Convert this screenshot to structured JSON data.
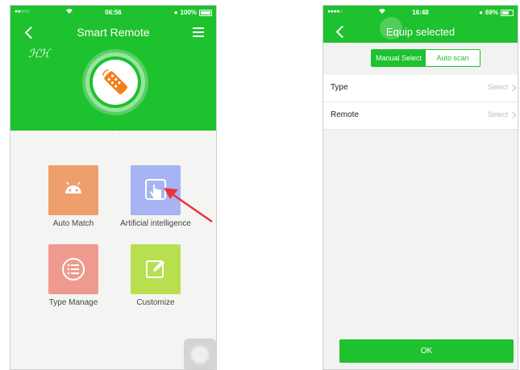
{
  "colors": {
    "brand_green": "#1ec12e",
    "tile_orange": "#ef9f6c",
    "tile_blue": "#a7b4f3",
    "tile_pink": "#ee9a8f",
    "tile_lime": "#b8df4f",
    "arrow_red": "#e8353a"
  },
  "left_screen": {
    "status": {
      "signal": "●●○○○",
      "wifi_icon": "wifi-icon",
      "time": "06:56",
      "battery": "100%"
    },
    "header": {
      "title": "Smart Remote",
      "back_icon": "chevron-left-icon",
      "menu_icon": "list-menu-icon",
      "logo_mark": "ℋℋ"
    },
    "hero_icon": "remote-control-icon",
    "carousel": {
      "pages": 2,
      "active": 1
    },
    "tiles": [
      {
        "label": "Auto Match",
        "icon": "android-icon"
      },
      {
        "label": "Artificial intelligence",
        "icon": "hand-tap-icon"
      },
      {
        "label": "Type Manage",
        "icon": "list-circle-icon"
      },
      {
        "label": "Customize",
        "icon": "edit-pencil-icon"
      }
    ]
  },
  "right_screen": {
    "status": {
      "signal": "●●●●○",
      "wifi_icon": "wifi-icon",
      "time": "16:48",
      "battery": "69%"
    },
    "header": {
      "title": "Equip selected",
      "back_icon": "chevron-left-icon"
    },
    "segmented": {
      "manual": "Manual Select",
      "auto": "Auto scan",
      "selected": "manual"
    },
    "rows": [
      {
        "label": "Type",
        "value": "Select"
      },
      {
        "label": "Remote",
        "value": "Select"
      }
    ],
    "ok_button": "OK"
  }
}
